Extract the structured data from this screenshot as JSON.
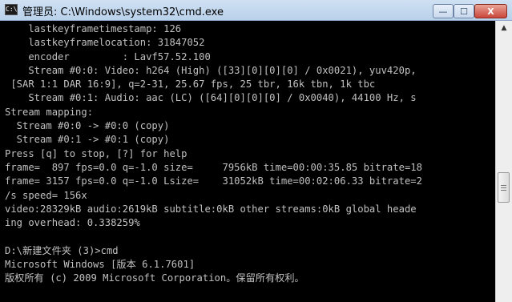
{
  "window": {
    "title": "管理员: C:\\Windows\\system32\\cmd.exe",
    "app_icon_text": "C:\\",
    "controls": {
      "minimize": "—",
      "maximize": "☐",
      "close": "X"
    }
  },
  "console": {
    "lines": [
      "    lastkeyframetimestamp: 126",
      "    lastkeyframelocation: 31847052",
      "    encoder         : Lavf57.52.100",
      "    Stream #0:0: Video: h264 (High) ([33][0][0][0] / 0x0021), yuv420p,",
      " [SAR 1:1 DAR 16:9], q=2-31, 25.67 fps, 25 tbr, 16k tbn, 1k tbc",
      "    Stream #0:1: Audio: aac (LC) ([64][0][0][0] / 0x0040), 44100 Hz, s",
      "Stream mapping:",
      "  Stream #0:0 -> #0:0 (copy)",
      "  Stream #0:1 -> #0:1 (copy)",
      "Press [q] to stop, [?] for help",
      "frame=  897 fps=0.0 q=-1.0 size=     7956kB time=00:00:35.85 bitrate=18",
      "frame= 3157 fps=0.0 q=-1.0 Lsize=    31052kB time=00:02:06.33 bitrate=2",
      "/s speed= 156x",
      "video:28329kB audio:2619kB subtitle:0kB other streams:0kB global heade",
      "ing overhead: 0.338259%",
      "",
      "D:\\新建文件夹 (3)>cmd",
      "Microsoft Windows [版本 6.1.7601]",
      "版权所有 (c) 2009 Microsoft Corporation。保留所有权利。",
      ""
    ]
  },
  "scrollbar": {
    "up_arrow": "▲"
  }
}
